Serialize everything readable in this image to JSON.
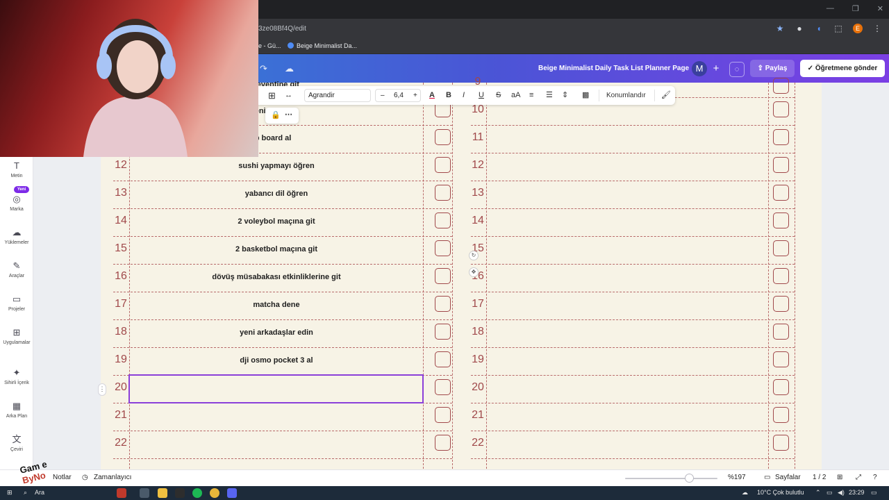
{
  "browser": {
    "url": "3ze08Bf4Q/edit",
    "bookmarks": [
      "e - Gü...",
      "Beige Minimalist Da..."
    ],
    "profile_initial": "E"
  },
  "header": {
    "doc_title": "Beige Minimalist Daily Task List Planner Page",
    "avatar_initial": "M",
    "share_label": "Paylaş",
    "teacher_label": "Öğretmene gönder"
  },
  "toolbar": {
    "font": "Agrandir",
    "size": "6,4",
    "bold": "B",
    "italic": "I",
    "underline": "U",
    "strike": "S",
    "case": "aA",
    "position_label": "Konumlandır"
  },
  "sidebar": {
    "new_badge": "Yeni",
    "items": [
      {
        "label": "Metin",
        "icon": "T"
      },
      {
        "label": "Marka",
        "icon": "◎"
      },
      {
        "label": "Yüklemeler",
        "icon": "☁"
      },
      {
        "label": "Araçlar",
        "icon": "✎"
      },
      {
        "label": "Projeler",
        "icon": "▭"
      },
      {
        "label": "Uygulamalar",
        "icon": "⊞"
      },
      {
        "label": "Sihirli İçerik",
        "icon": "✦"
      },
      {
        "label": "Arka Plan",
        "icon": "▦"
      },
      {
        "label": "Çeviri",
        "icon": "文"
      }
    ]
  },
  "planner": {
    "partial_top": [
      "n eventine git",
      "deni  a çık",
      "up board al"
    ],
    "left_numbers": [
      "12",
      "13",
      "14",
      "15",
      "16",
      "17",
      "18",
      "19",
      "20",
      "21",
      "22"
    ],
    "tasks": [
      "sushi yapmayı öğren",
      "yabancı dil öğren",
      "2 voleybol maçına git",
      "2 basketbol maçına git",
      "dövüş müsabakası etkinliklerine git",
      "matcha dene",
      "yeni arkadaşlar edin",
      "dji osmo pocket 3 al",
      "",
      "",
      ""
    ],
    "right_numbers": [
      "9",
      "10",
      "11",
      "12",
      "13",
      "14",
      "15",
      "16",
      "17",
      "18",
      "19",
      "20",
      "21",
      "22"
    ]
  },
  "bottom_bar": {
    "notes_label": "Notlar",
    "timer_label": "Zamanlayıcı",
    "zoom": "%197",
    "pages_label": "Sayfalar",
    "page_count": "1 / 2",
    "zoom_fraction": 0.69
  },
  "taskbar": {
    "search": "Ara",
    "weather": "10°C  Çok bulutlu",
    "time": "23:29"
  },
  "overlay": {
    "logo_text": "Gam e",
    "logo_sub": "ByNo"
  },
  "colors": {
    "accent": "#8b3fd9",
    "planner_red": "#a0484a",
    "page_bg": "#f7f3e6"
  }
}
